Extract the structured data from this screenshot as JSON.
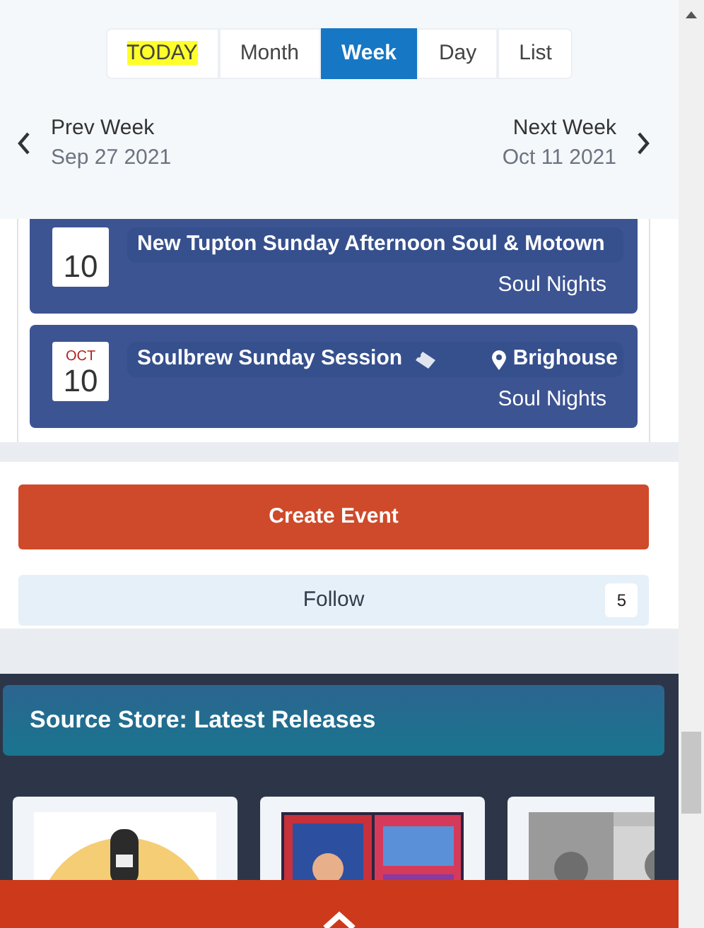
{
  "view_tabs": [
    {
      "label": "TODAY",
      "selected": false,
      "highlighted": true
    },
    {
      "label": "Month",
      "selected": false,
      "highlighted": false
    },
    {
      "label": "Week",
      "selected": true,
      "highlighted": false
    },
    {
      "label": "Day",
      "selected": false,
      "highlighted": false
    },
    {
      "label": "List",
      "selected": false,
      "highlighted": false
    }
  ],
  "week_nav": {
    "prev": {
      "label": "Prev Week",
      "date": "Sep 27 2021"
    },
    "next": {
      "label": "Next Week",
      "date": "Oct 11 2021"
    }
  },
  "events": [
    {
      "day": "10",
      "title": "New Tupton Sunday Afternoon Soul & Motown",
      "category": "Soul Nights"
    },
    {
      "month": "OCT",
      "day": "10",
      "title": "Soulbrew Sunday Session",
      "ticket": true,
      "location": "Brighouse",
      "category": "Soul Nights"
    }
  ],
  "create_button": "Create Event",
  "follow_button": {
    "label": "Follow",
    "count": "5"
  },
  "store": {
    "title": "Source Store: Latest Releases"
  }
}
